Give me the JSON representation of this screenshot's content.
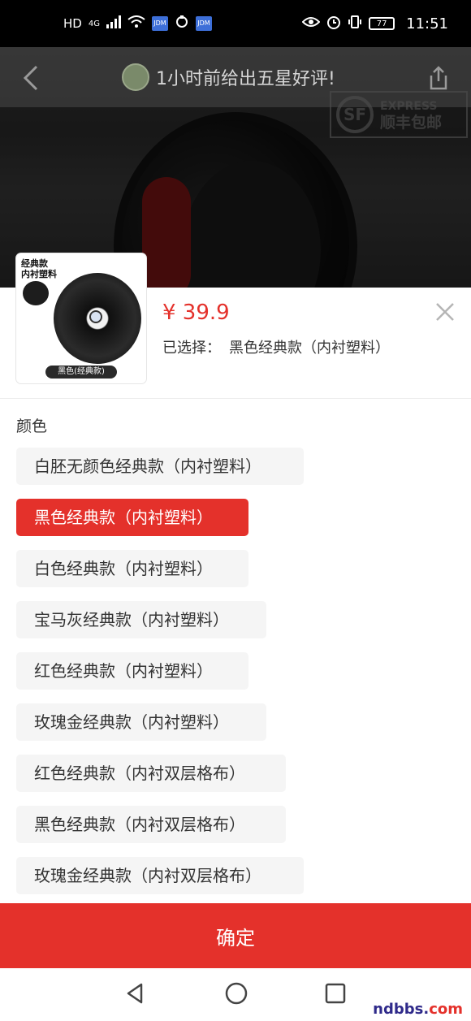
{
  "status_bar": {
    "left_text": "HD",
    "network": "4G",
    "badge1": "JDM",
    "badge2": "JDM",
    "battery": "77",
    "time": "11:51"
  },
  "hero": {
    "notice_text": "1小时前给出五星好评!",
    "sf_latin": "EXPRESS",
    "sf_text": "顺丰包邮",
    "sf_mark": "SF"
  },
  "product": {
    "thumb_label_1": "经典款",
    "thumb_label_2": "内衬塑料",
    "thumb_caption": "黑色(经典款)",
    "price": "¥ 39.9",
    "selected_label": "已选择：",
    "selected_value": "黑色经典款（内衬塑料）"
  },
  "color_group": {
    "title": "颜色",
    "selected_index": 1,
    "options": [
      "白胚无颜色经典款（内衬塑料）",
      "黑色经典款（内衬塑料）",
      "白色经典款（内衬塑料）",
      "宝马灰经典款（内衬塑料）",
      "红色经典款（内衬塑料）",
      "玫瑰金经典款（内衬塑料）",
      "红色经典款（内衬双层格布）",
      "黑色经典款（内衬双层格布）",
      "玫瑰金经典款（内衬双层格布）"
    ]
  },
  "confirm_label": "确定",
  "watermark": {
    "left": "ndbbs.",
    "right": "com"
  },
  "colors": {
    "accent": "#e4312b",
    "option_bg": "#f5f5f5"
  }
}
